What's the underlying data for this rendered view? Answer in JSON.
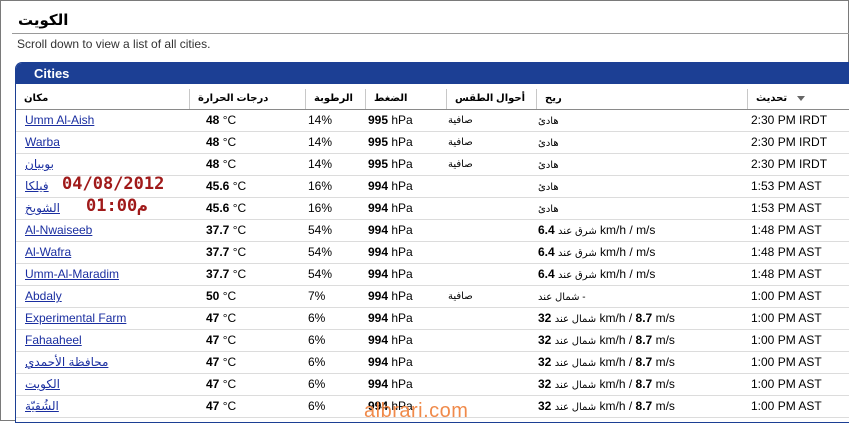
{
  "page": {
    "title": "الكويت",
    "subtitle": "Scroll down to view a list of all cities."
  },
  "panel": {
    "title": "Cities"
  },
  "columns": {
    "place": "مكان",
    "temp": "درجات الحرارة",
    "humidity": "الرطوبة",
    "pressure": "الضغط",
    "conditions": "أحوال الطقس",
    "wind": "ريح",
    "updated": "تحديث"
  },
  "rows": [
    {
      "place": "Umm Al-Aish",
      "temp": "48",
      "temp_unit": "°C",
      "humidity": "14%",
      "pressure": "995",
      "pressure_unit": "hPa",
      "conditions": "صافية",
      "wind_speed": "",
      "wind_text": "هادئ",
      "wind_mid": "",
      "wind_ms": "",
      "wind_unit": "",
      "updated": "2:30 PM IRDT"
    },
    {
      "place": "Warba",
      "temp": "48",
      "temp_unit": "°C",
      "humidity": "14%",
      "pressure": "995",
      "pressure_unit": "hPa",
      "conditions": "صافية",
      "wind_speed": "",
      "wind_text": "هادئ",
      "wind_mid": "",
      "wind_ms": "",
      "wind_unit": "",
      "updated": "2:30 PM IRDT"
    },
    {
      "place": "بوبيان",
      "temp": "48",
      "temp_unit": "°C",
      "humidity": "14%",
      "pressure": "995",
      "pressure_unit": "hPa",
      "conditions": "صافية",
      "wind_speed": "",
      "wind_text": "هادئ",
      "wind_mid": "",
      "wind_ms": "",
      "wind_unit": "",
      "updated": "2:30 PM IRDT"
    },
    {
      "place": "فيلكا",
      "temp": "45.6",
      "temp_unit": "°C",
      "humidity": "16%",
      "pressure": "994",
      "pressure_unit": "hPa",
      "conditions": "",
      "wind_speed": "",
      "wind_text": "هادئ",
      "wind_mid": "",
      "wind_ms": "",
      "wind_unit": "",
      "updated": "1:53 PM AST"
    },
    {
      "place": "الشويخ",
      "temp": "45.6",
      "temp_unit": "°C",
      "humidity": "16%",
      "pressure": "994",
      "pressure_unit": "hPa",
      "conditions": "",
      "wind_speed": "",
      "wind_text": "هادئ",
      "wind_mid": "",
      "wind_ms": "",
      "wind_unit": "",
      "updated": "1:53 PM AST"
    },
    {
      "place": "Al-Nwaiseeb",
      "temp": "37.7",
      "temp_unit": "°C",
      "humidity": "54%",
      "pressure": "994",
      "pressure_unit": "hPa",
      "conditions": "",
      "wind_speed": "6.4",
      "wind_text": "شرق عند",
      "wind_mid": "km/h /",
      "wind_ms": "",
      "wind_unit": "m/s",
      "updated": "1:48 PM AST"
    },
    {
      "place": "Al-Wafra",
      "temp": "37.7",
      "temp_unit": "°C",
      "humidity": "54%",
      "pressure": "994",
      "pressure_unit": "hPa",
      "conditions": "",
      "wind_speed": "6.4",
      "wind_text": "شرق عند",
      "wind_mid": "km/h /",
      "wind_ms": "",
      "wind_unit": "m/s",
      "updated": "1:48 PM AST"
    },
    {
      "place": "Umm-Al-Maradim",
      "temp": "37.7",
      "temp_unit": "°C",
      "humidity": "54%",
      "pressure": "994",
      "pressure_unit": "hPa",
      "conditions": "",
      "wind_speed": "6.4",
      "wind_text": "شرق عند",
      "wind_mid": "km/h /",
      "wind_ms": "",
      "wind_unit": "m/s",
      "updated": "1:48 PM AST"
    },
    {
      "place": "Abdaly",
      "temp": "50",
      "temp_unit": "°C",
      "humidity": "7%",
      "pressure": "994",
      "pressure_unit": "hPa",
      "conditions": "صافية",
      "wind_speed": "",
      "wind_text": "شمال عند -",
      "wind_mid": "",
      "wind_ms": "",
      "wind_unit": "",
      "updated": "1:00 PM AST"
    },
    {
      "place": "Experimental Farm",
      "temp": "47",
      "temp_unit": "°C",
      "humidity": "6%",
      "pressure": "994",
      "pressure_unit": "hPa",
      "conditions": "",
      "wind_speed": "32",
      "wind_text": "شمال عند",
      "wind_mid": "km/h /",
      "wind_ms": "8.7",
      "wind_unit": "m/s",
      "updated": "1:00 PM AST"
    },
    {
      "place": "Fahaaheel",
      "temp": "47",
      "temp_unit": "°C",
      "humidity": "6%",
      "pressure": "994",
      "pressure_unit": "hPa",
      "conditions": "",
      "wind_speed": "32",
      "wind_text": "شمال عند",
      "wind_mid": "km/h /",
      "wind_ms": "8.7",
      "wind_unit": "m/s",
      "updated": "1:00 PM AST"
    },
    {
      "place": "محافظة الأحمدي",
      "temp": "47",
      "temp_unit": "°C",
      "humidity": "6%",
      "pressure": "994",
      "pressure_unit": "hPa",
      "conditions": "",
      "wind_speed": "32",
      "wind_text": "شمال عند",
      "wind_mid": "km/h /",
      "wind_ms": "8.7",
      "wind_unit": "m/s",
      "updated": "1:00 PM AST"
    },
    {
      "place": "الكويت",
      "temp": "47",
      "temp_unit": "°C",
      "humidity": "6%",
      "pressure": "994",
      "pressure_unit": "hPa",
      "conditions": "",
      "wind_speed": "32",
      "wind_text": "شمال عند",
      "wind_mid": "km/h /",
      "wind_ms": "8.7",
      "wind_unit": "m/s",
      "updated": "1:00 PM AST"
    },
    {
      "place": "الشُقيّة",
      "temp": "47",
      "temp_unit": "°C",
      "humidity": "6%",
      "pressure": "994",
      "pressure_unit": "hPa",
      "conditions": "",
      "wind_speed": "32",
      "wind_text": "شمال عند",
      "wind_mid": "km/h /",
      "wind_ms": "8.7",
      "wind_unit": "m/s",
      "updated": "1:00 PM AST"
    }
  ],
  "overlay": {
    "date": "04/08/2012",
    "time": "01:00م"
  },
  "watermark": "albrari.com",
  "colors": {
    "header_blue": "#1c3f94",
    "link": "#1a2ea0",
    "overlay": "#a01a1a",
    "watermark": "#f08a4a"
  },
  "icons": {
    "sort": "sort-desc-icon"
  }
}
